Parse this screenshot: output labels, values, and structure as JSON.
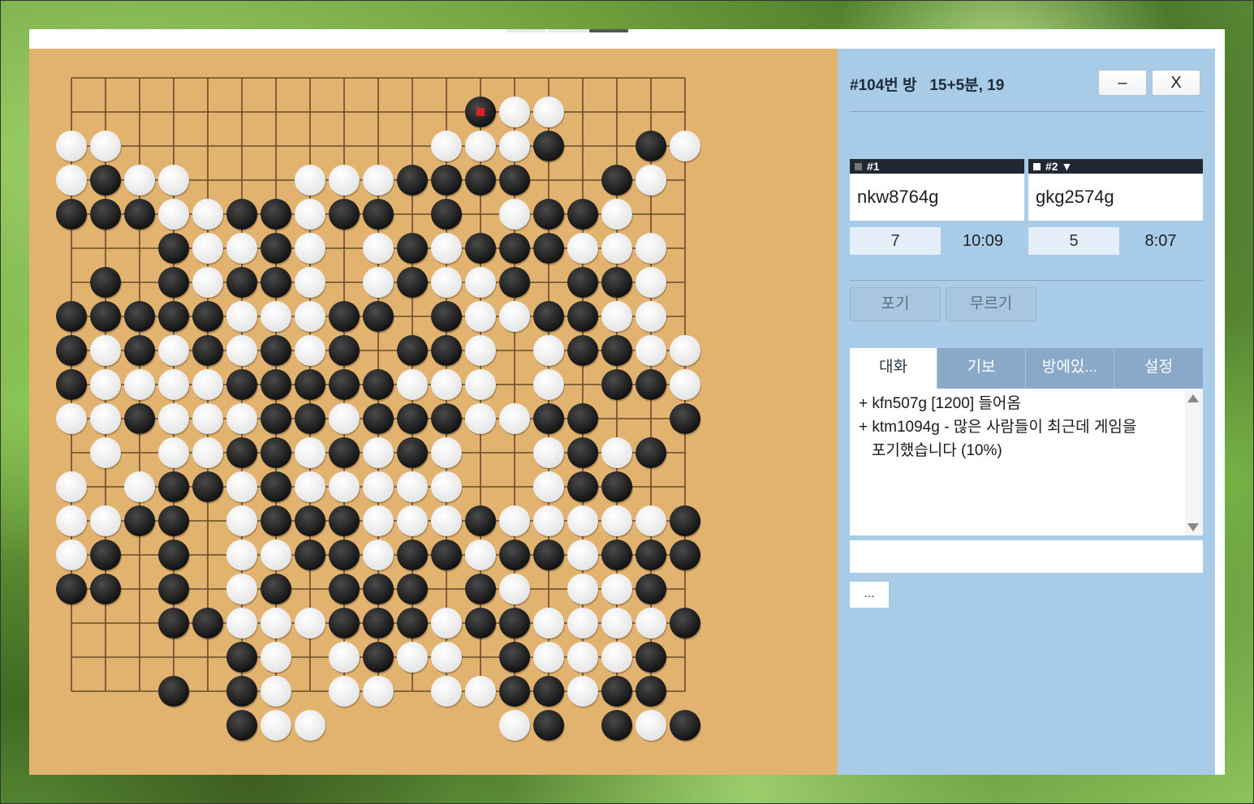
{
  "room": {
    "title": "#104번 방   15+5분, 19",
    "minimize_label": "–",
    "close_label": "X"
  },
  "players": [
    {
      "tag": "#1",
      "stone": "black",
      "name": "nkw8764g",
      "score": "7",
      "time": "10:09"
    },
    {
      "tag": "#2 ▼",
      "stone": "white",
      "name": "gkg2574g",
      "score": "5",
      "time": "8:07"
    }
  ],
  "actions": {
    "resign": "포기",
    "undo": "무르기"
  },
  "tabs": [
    "대화",
    "기보",
    "방에있...",
    "설정"
  ],
  "chat": {
    "messages": [
      "+ kfn507g [1200] 들어옴",
      "+ ktm1094g - 많은 사람들이 최근데 게임을",
      "   포기했습니다 (10%)"
    ],
    "input_value": "",
    "more_label": "..."
  },
  "board": {
    "size": 19,
    "last_move": "1,12",
    "stones": [
      "...................",
      "............XOO....",
      "OO.........OOOX..XO",
      "OXOO...OOOXXXX..XO.",
      "XXXOOXXOXX.X.OXXO..",
      "...XOOXO.OXOXXXOOO.",
      ".X.XOXXO.OXOOX.XXO.",
      "XXXXXOOOXX.XOOXXOO.",
      "XOXOXOXOX.XXO.OXXOO",
      "XOOOOXXXXXOOO.O.XXO",
      "OOXOOOXXOXXXOOXX..X",
      ".O.OOXXOXOXO..OXOX.",
      "O.OXXOXOOOOO..OXX..",
      "OOXX.OXXXOOOXOOOOOX",
      "OX.X.OOXXOXXOXXOXXX",
      "XX.X.OX.XXX.XO.OOX.",
      "...XXOOOXXXOXXOOOOX",
      ".....XO.OXOO.XOOOX.",
      "...X.XO.OO.OOXXOXX.",
      ".....XOO.....OX.XOX"
    ]
  },
  "colors": {
    "board": "#e2b36f",
    "panel": "#a8cbe8",
    "last_move_marker": "#e02020"
  }
}
